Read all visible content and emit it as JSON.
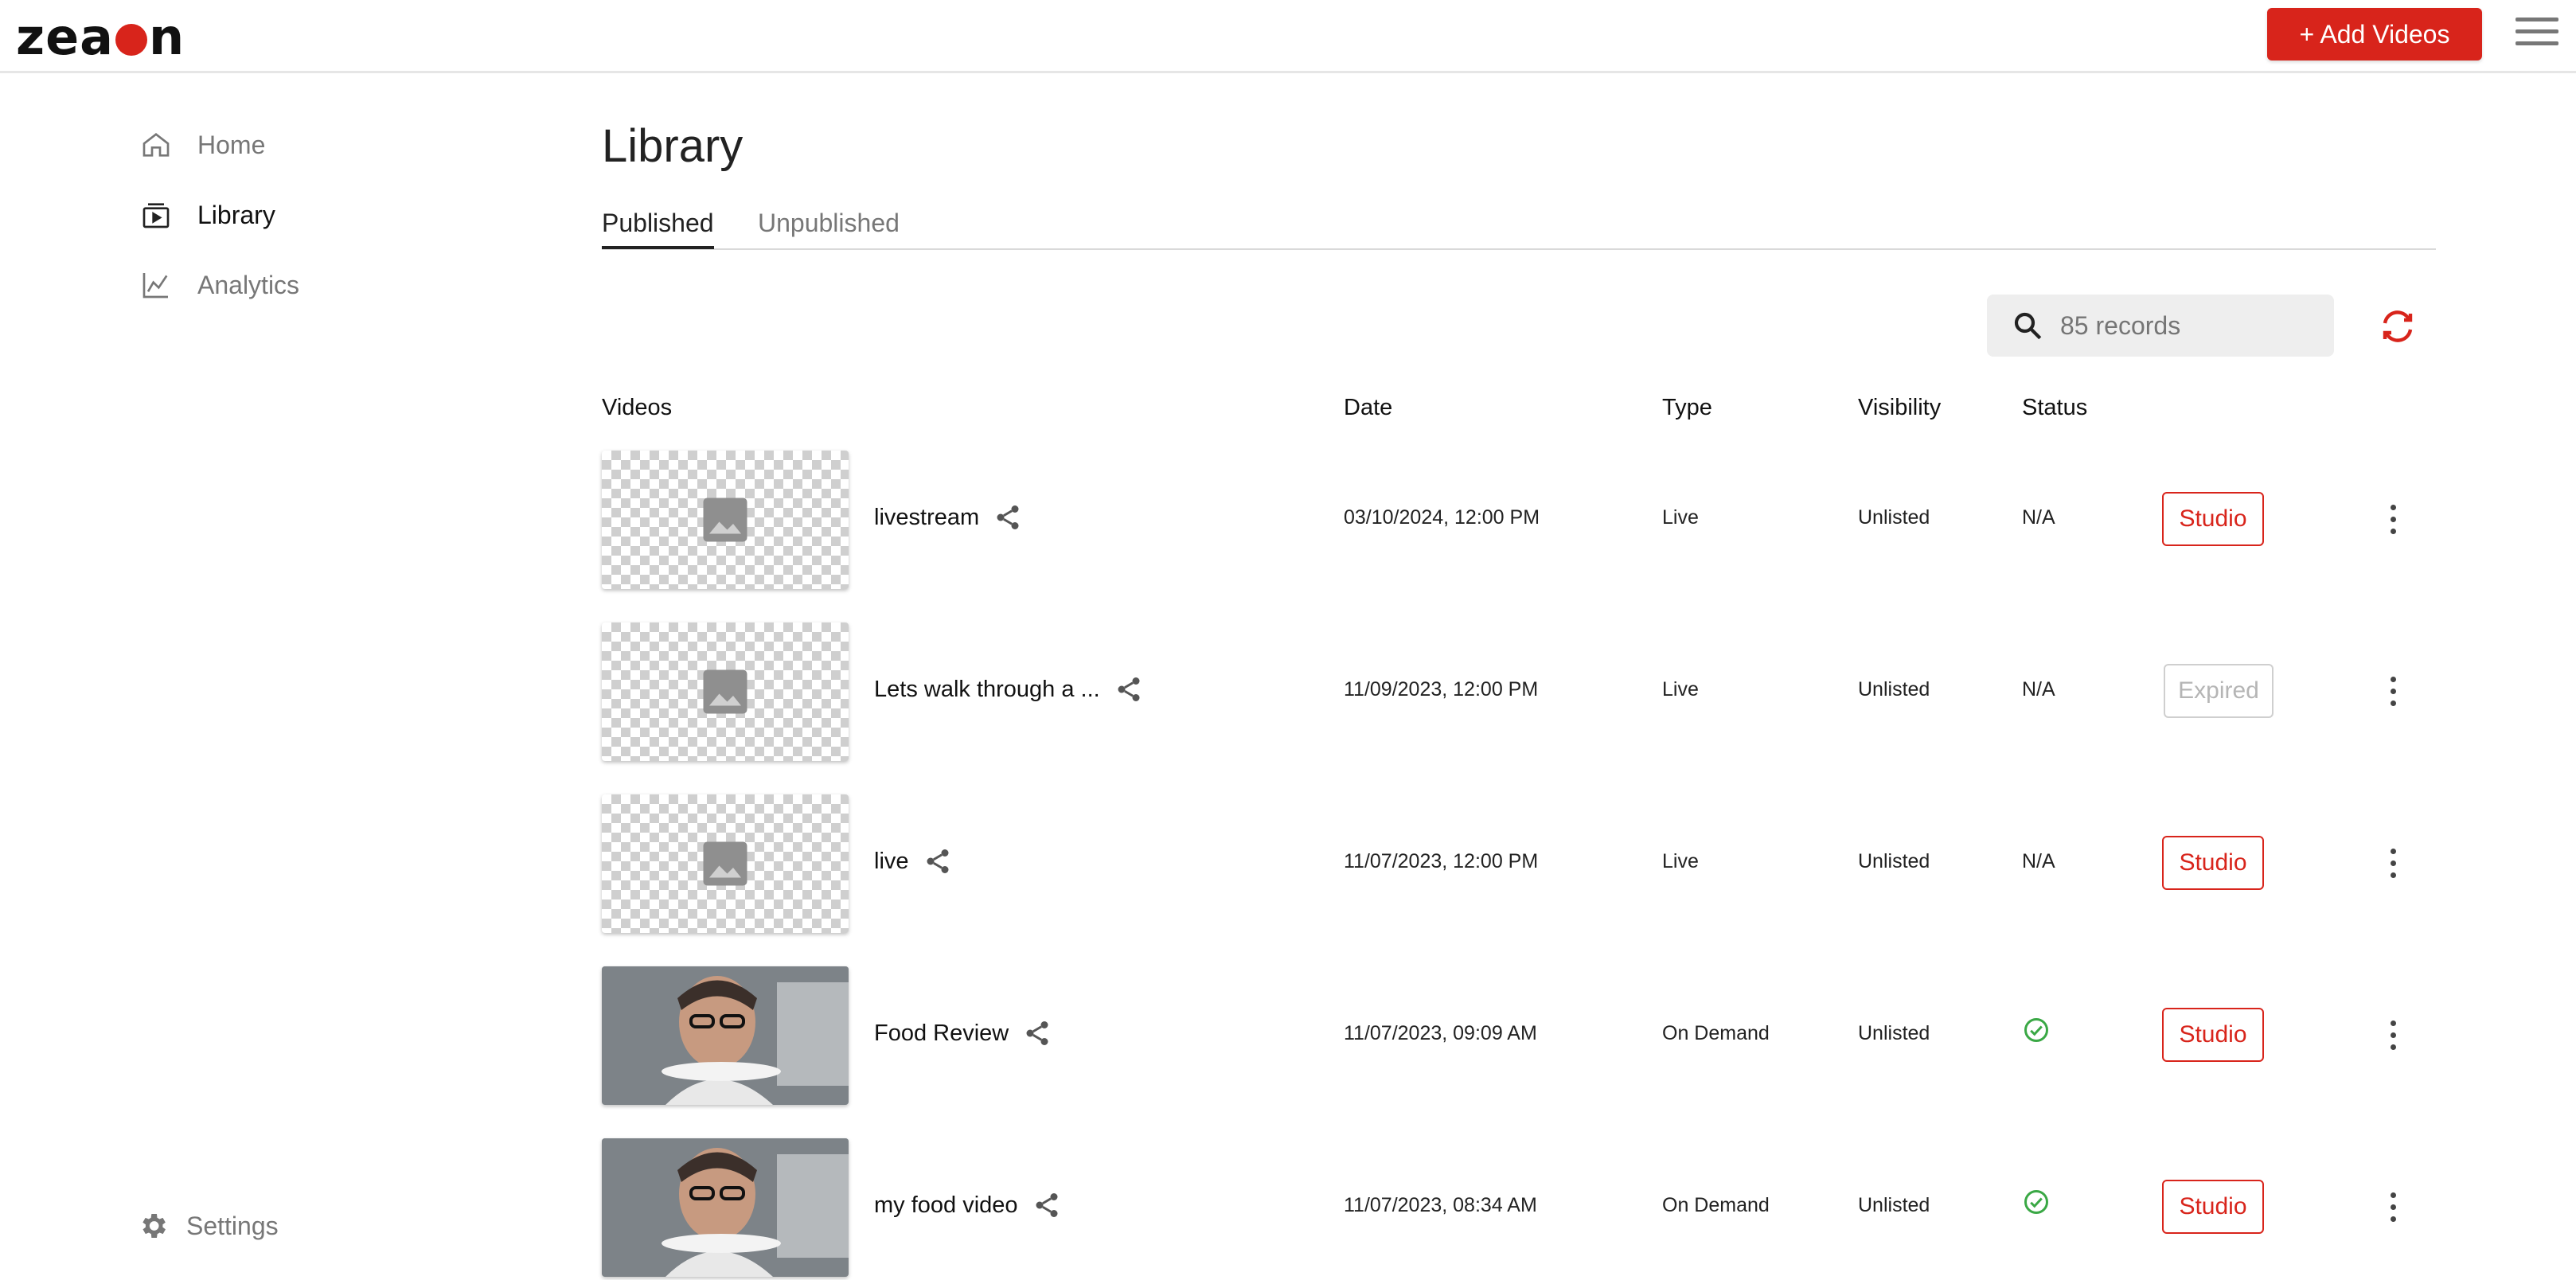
{
  "header": {
    "logo": "zeacon",
    "add_button": "+ Add Videos",
    "colors": {
      "accent": "#d8241b"
    }
  },
  "sidebar": {
    "items": [
      {
        "label": "Home",
        "icon": "home-icon"
      },
      {
        "label": "Library",
        "icon": "library-icon",
        "active": true
      },
      {
        "label": "Analytics",
        "icon": "analytics-icon"
      }
    ],
    "settings": "Settings"
  },
  "main": {
    "title": "Library",
    "tabs": [
      {
        "label": "Published",
        "active": true
      },
      {
        "label": "Unpublished"
      }
    ],
    "search": {
      "placeholder": "85 records"
    },
    "columns": [
      "Videos",
      "Date",
      "Type",
      "Visibility",
      "Status"
    ],
    "rows": [
      {
        "title": "livestream",
        "date": "03/10/2024, 12:00 PM",
        "type": "Live",
        "visibility": "Unlisted",
        "status": "N/A",
        "action": "Studio",
        "thumbnail": "placeholder"
      },
      {
        "title": "Lets walk through a ...",
        "date": "11/09/2023, 12:00 PM",
        "type": "Live",
        "visibility": "Unlisted",
        "status": "N/A",
        "action": "Expired",
        "thumbnail": "placeholder"
      },
      {
        "title": "live",
        "date": "11/07/2023, 12:00 PM",
        "type": "Live",
        "visibility": "Unlisted",
        "status": "N/A",
        "action": "Studio",
        "thumbnail": "placeholder"
      },
      {
        "title": "Food Review",
        "date": "11/07/2023, 09:09 AM",
        "type": "On Demand",
        "visibility": "Unlisted",
        "status": "check-circle-icon",
        "action": "Studio",
        "thumbnail": "photo"
      },
      {
        "title": "my food video",
        "date": "11/07/2023, 08:34 AM",
        "type": "On Demand",
        "visibility": "Unlisted",
        "status": "check-circle-icon",
        "action": "Studio",
        "thumbnail": "photo"
      }
    ]
  }
}
